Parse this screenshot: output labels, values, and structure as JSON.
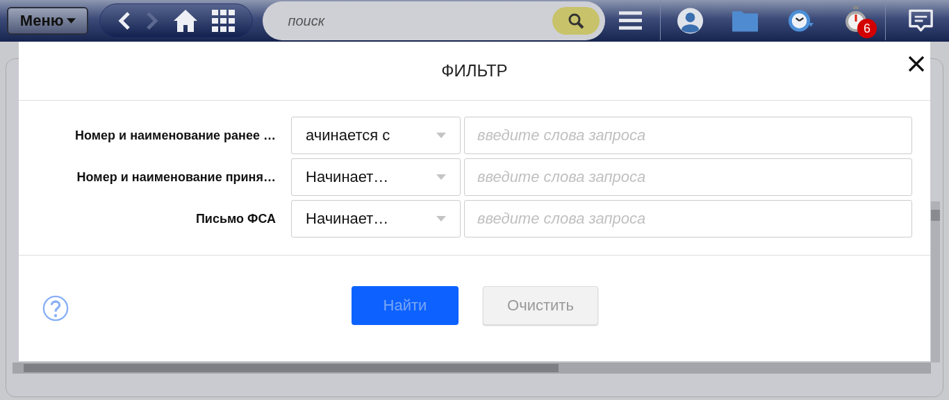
{
  "top_bar": {
    "menu_button": "Меню",
    "nav": [
      {
        "kind": "back",
        "disabled": false
      },
      {
        "kind": "forward",
        "disabled": true
      },
      {
        "kind": "home",
        "disabled": false
      },
      {
        "kind": "apps",
        "disabled": false
      }
    ],
    "search": {
      "placeholder": "поиск"
    },
    "timer_badge": "6"
  },
  "dialog": {
    "title": "ФИЛЬТР",
    "filters": [
      {
        "label": "Номер и наименование ранее …",
        "operator": "ачинается с",
        "placeholder": "введите слова запроса"
      },
      {
        "label": "Номер и наименование приня…",
        "operator": "Начинает…",
        "placeholder": "введите слова запроса"
      },
      {
        "label": "Письмо ФСА",
        "operator": "Начинает…",
        "placeholder": "введите слова запроса"
      }
    ],
    "buttons": [
      {
        "label": "Найти",
        "kind": "primary",
        "disabled": true
      },
      {
        "label": "Очистить",
        "kind": "secondary",
        "disabled": true
      }
    ]
  }
}
